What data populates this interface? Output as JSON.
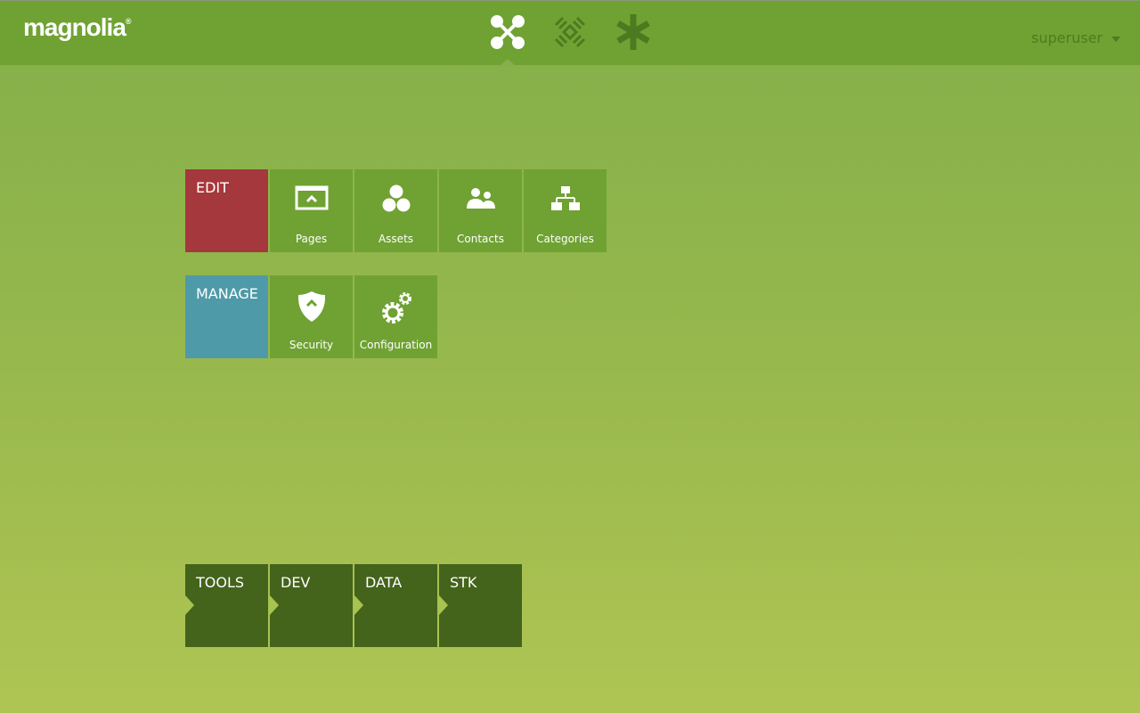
{
  "header": {
    "logo": "magnolia",
    "logo_mark": "®",
    "apps": [
      {
        "name": "applauncher",
        "icon": "apps-x-icon",
        "active": true
      },
      {
        "name": "pulse",
        "icon": "pulse-diamond-icon",
        "active": false
      },
      {
        "name": "favorites",
        "icon": "asterisk-icon",
        "active": false
      }
    ],
    "user": "superuser"
  },
  "colors": {
    "header": "#6fa232",
    "edit": "#a5383c",
    "manage": "#4f9aa8",
    "tile": "#6fa232",
    "group_dark": "#44631b"
  },
  "groups": [
    {
      "label": "EDIT",
      "apps": [
        {
          "label": "Pages",
          "icon": "pages-icon"
        },
        {
          "label": "Assets",
          "icon": "assets-icon"
        },
        {
          "label": "Contacts",
          "icon": "contacts-icon"
        },
        {
          "label": "Categories",
          "icon": "categories-icon"
        }
      ]
    },
    {
      "label": "MANAGE",
      "apps": [
        {
          "label": "Security",
          "icon": "security-icon"
        },
        {
          "label": "Configuration",
          "icon": "configuration-icon"
        }
      ]
    }
  ],
  "collapsed_groups": [
    {
      "label": "TOOLS"
    },
    {
      "label": "DEV"
    },
    {
      "label": "DATA"
    },
    {
      "label": "STK"
    }
  ]
}
